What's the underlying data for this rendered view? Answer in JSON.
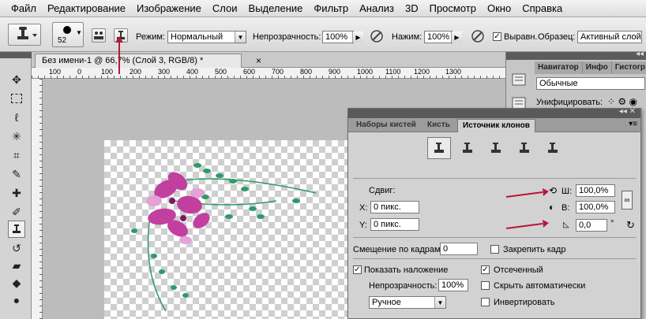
{
  "menu": [
    "Файл",
    "Редактирование",
    "Изображение",
    "Слои",
    "Выделение",
    "Фильтр",
    "Анализ",
    "3D",
    "Просмотр",
    "Окно",
    "Справка"
  ],
  "options": {
    "brush_size": "52",
    "mode_label": "Режим:",
    "mode_value": "Нормальный",
    "opacity_label": "Непрозрачность:",
    "opacity_value": "100%",
    "pressure_label": "Нажим:",
    "pressure_value": "100%",
    "aligned_label": "Выравн.",
    "sample_label": "Образец:",
    "sample_value": "Активный слой"
  },
  "document": {
    "tab_title": "Без имени-1 @ 66,7% (Слой 3, RGB/8) *",
    "close_glyph": "×",
    "ruler_labels": [
      "100",
      "0",
      "100",
      "200",
      "300",
      "400",
      "500",
      "600",
      "700",
      "800",
      "900",
      "1000",
      "1100",
      "1200",
      "1300"
    ]
  },
  "dock": {
    "tabs": [
      "Навигатор",
      "Инфо",
      "Гистогр"
    ],
    "blend_value": "Обычные",
    "unify_label": "Унифицировать:"
  },
  "panel": {
    "tabs": [
      "Наборы кистей",
      "Кисть",
      "Источник клонов"
    ],
    "offset_label": "Сдвиг:",
    "x_label": "X:",
    "x_value": "0 пикс.",
    "y_label": "Y:",
    "y_value": "0 пикс.",
    "w_label": "Ш:",
    "w_value": "100,0%",
    "h_label": "В:",
    "h_value": "100,0%",
    "angle_value": "0,0",
    "degree": "°",
    "frame_offset_label": "Смещение по кадрам:",
    "frame_offset_value": "0",
    "lock_frame_label": "Закрепить кадр",
    "show_overlay_label": "Показать наложение",
    "clipped_label": "Отсеченный",
    "overlay_opacity_label": "Непрозрачность:",
    "overlay_opacity_value": "100%",
    "auto_hide_label": "Скрыть автоматически",
    "mode_value": "Ручное",
    "invert_label": "Инвертировать",
    "checked": {
      "show_overlay": true,
      "clipped": true,
      "lock_frame": false,
      "auto_hide": false,
      "invert": false
    }
  },
  "colors": {
    "annotation_arrow": "#b5173b",
    "flower_pink": "#c23fa0",
    "leaf_green": "#2e9a6a"
  }
}
